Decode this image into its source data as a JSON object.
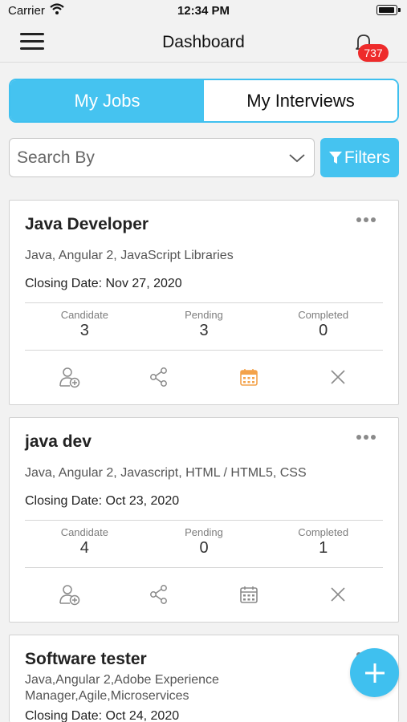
{
  "status_bar": {
    "carrier": "Carrier",
    "time": "12:34 PM"
  },
  "header": {
    "title": "Dashboard",
    "notification_count": "737",
    "icons": {
      "menu": "hamburger-icon",
      "notifications": "bell-icon"
    }
  },
  "tabs": [
    {
      "label": "My Jobs",
      "active": true
    },
    {
      "label": "My Interviews",
      "active": false
    }
  ],
  "search": {
    "placeholder": "Search By"
  },
  "filters": {
    "label": "Filters",
    "icon": "funnel-icon"
  },
  "stat_labels": {
    "candidate": "Candidate",
    "pending": "Pending",
    "completed": "Completed"
  },
  "jobs": [
    {
      "title": "Java Developer",
      "skills": "Java, Angular 2, JavaScript Libraries",
      "closing": "Closing Date: Nov 27, 2020",
      "candidate": "3",
      "pending": "3",
      "completed": "0",
      "calendar_highlighted": true
    },
    {
      "title": "java dev",
      "skills": "Java, Angular 2, Javascript, HTML / HTML5, CSS",
      "closing": "Closing Date: Oct 23, 2020",
      "candidate": "4",
      "pending": "0",
      "completed": "1",
      "calendar_highlighted": false
    },
    {
      "title": "Software tester",
      "skills": "Java,Angular 2,Adobe Experience Manager,Agile,Microservices",
      "closing": "Closing Date: Oct 24, 2020"
    }
  ],
  "action_icons": [
    "add-candidate-icon",
    "share-icon",
    "calendar-icon",
    "close-icon"
  ],
  "colors": {
    "accent": "#45c3f0",
    "badge": "#ee2b2b",
    "calendar_active": "#f3a24a",
    "icon_gray": "#8a8a8a"
  },
  "fab": {
    "icon": "plus-icon"
  }
}
